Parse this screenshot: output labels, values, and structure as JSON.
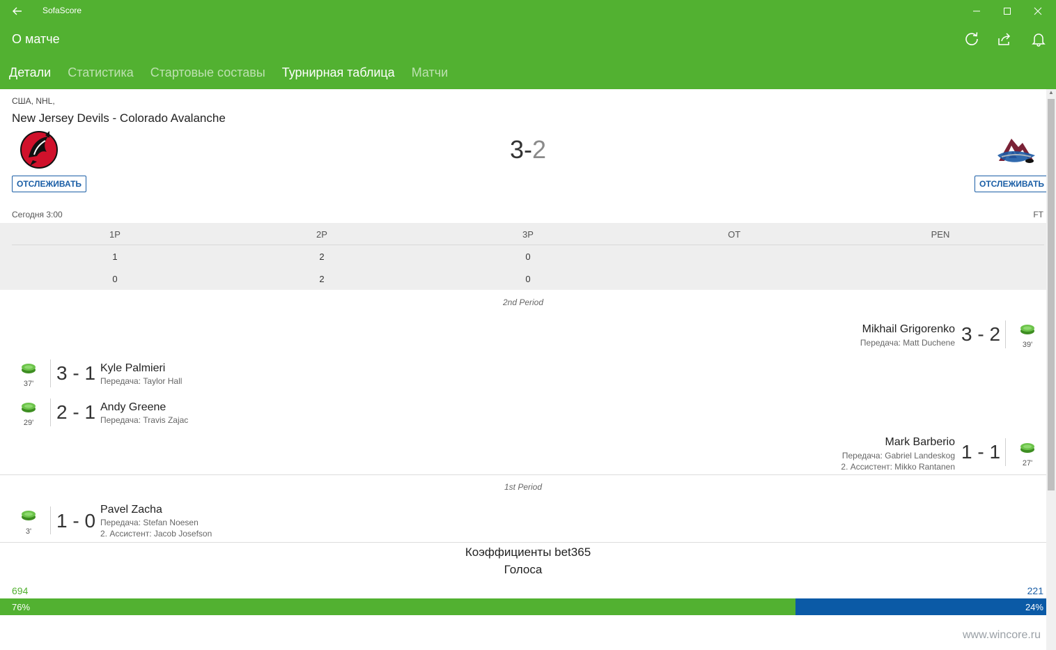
{
  "window": {
    "app_title": "SofaScore"
  },
  "header": {
    "page_title": "О матче",
    "tabs": [
      {
        "label": "Детали"
      },
      {
        "label": "Статистика"
      },
      {
        "label": "Стартовые составы"
      },
      {
        "label": "Турнирная таблица"
      },
      {
        "label": "Матчи"
      }
    ],
    "active_tab": "Детали"
  },
  "match": {
    "league": "США, NHL,",
    "title": "New Jersey Devils - Colorado Avalanche",
    "score_home": "3",
    "score_sep": "-",
    "score_away": "2",
    "follow_label": "ОТСЛЕЖИВАТЬ",
    "date": "Сегодня 3:00",
    "status": "FT"
  },
  "periods": {
    "headers": [
      "1P",
      "2P",
      "3P",
      "OT",
      "PEN"
    ],
    "home": [
      "1",
      "2",
      "0",
      "",
      ""
    ],
    "away": [
      "0",
      "2",
      "0",
      "",
      ""
    ]
  },
  "incidents": {
    "period2_label": "2nd Period",
    "period1_label": "1st Period",
    "goals": [
      {
        "side": "away",
        "score": "3 - 2",
        "player": "Mikhail Grigorenko",
        "assist1": "Передача: Matt Duchene",
        "assist2": "",
        "minute": "39'"
      },
      {
        "side": "home",
        "score": "3 - 1",
        "player": "Kyle Palmieri",
        "assist1": "Передача: Taylor Hall",
        "assist2": "",
        "minute": "37'"
      },
      {
        "side": "home",
        "score": "2 - 1",
        "player": "Andy Greene",
        "assist1": "Передача: Travis Zajac",
        "assist2": "",
        "minute": "29'"
      },
      {
        "side": "away",
        "score": "1 - 1",
        "player": "Mark Barberio",
        "assist1": "Передача: Gabriel Landeskog",
        "assist2": "2. Ассистент: Mikko Rantanen",
        "minute": "27'"
      },
      {
        "side": "home",
        "score": "1 - 0",
        "player": "Pavel Zacha",
        "assist1": "Передача: Stefan Noesen",
        "assist2": "2. Ассистент: Jacob Josefson",
        "minute": "3'"
      }
    ]
  },
  "votes": {
    "title": "Голоса",
    "home_count": "694",
    "away_count": "221",
    "home_percent": "76%",
    "away_percent": "24%",
    "home_share": 0.76
  },
  "odds": {
    "title": "Коэффициенты bet365"
  },
  "watermark": "www.wincore.ru",
  "colors": {
    "brand": "#52b131",
    "away": "#0b5aa6",
    "follow": "#1a5ea6"
  },
  "icons": [
    "back-arrow-icon",
    "minimize-icon",
    "maximize-icon",
    "close-icon",
    "refresh-icon",
    "share-icon",
    "bell-icon",
    "puck-icon"
  ]
}
